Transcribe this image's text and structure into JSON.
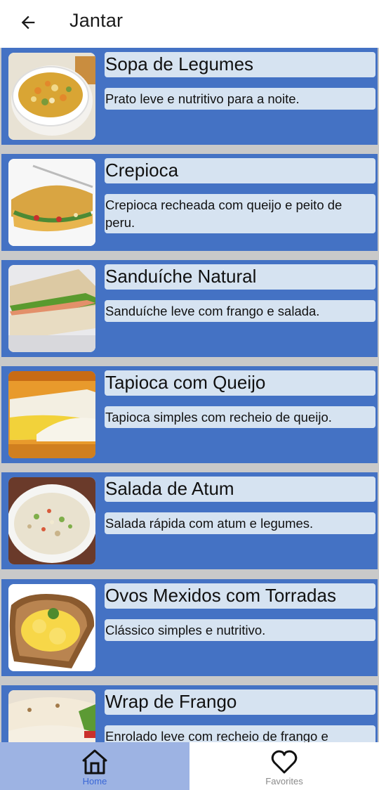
{
  "app_bar": {
    "title": "Jantar",
    "back_icon": "arrow-left-icon"
  },
  "colors": {
    "card_bg": "#4472c4",
    "label_bg": "#d6e3f1",
    "divider": "#c9c9c9",
    "nav_active_bg": "#9db3e3",
    "nav_active_text": "#3a67d6"
  },
  "recipes": [
    {
      "name": "Sopa de Legumes",
      "description": "Prato leve e nutritivo para a noite.",
      "image": "vegetable-soup-photo"
    },
    {
      "name": "Crepioca",
      "description": "Crepioca recheada com queijo e peito de peru.",
      "image": "crepioca-photo"
    },
    {
      "name": "Sanduíche Natural",
      "description": "Sanduíche leve com frango e salada.",
      "image": "sandwich-photo"
    },
    {
      "name": "Tapioca com Queijo",
      "description": "Tapioca simples com recheio de queijo.",
      "image": "tapioca-photo"
    },
    {
      "name": "Salada de Atum",
      "description": "Salada rápida com atum e legumes.",
      "image": "tuna-salad-photo"
    },
    {
      "name": "Ovos Mexidos com Torradas",
      "description": "Clássico simples e nutritivo.",
      "image": "scrambled-eggs-toast-photo"
    },
    {
      "name": "Wrap de Frango",
      "description": "Enrolado leve com recheio de frango e",
      "image": "chicken-wrap-photo"
    }
  ],
  "bottom_nav": {
    "items": [
      {
        "label": "Home",
        "icon": "home-icon",
        "active": true
      },
      {
        "label": "Favorites",
        "icon": "heart-icon",
        "active": false
      }
    ]
  }
}
